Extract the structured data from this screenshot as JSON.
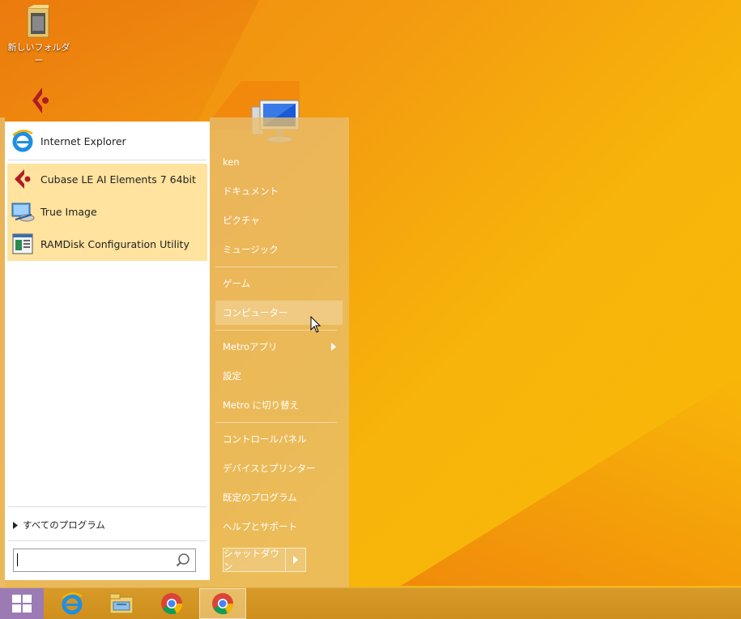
{
  "desktop": {
    "icons": [
      {
        "label": "新しいフォルダー"
      }
    ]
  },
  "start_menu": {
    "pinned": [
      {
        "label": "Internet Explorer",
        "icon": "ie-icon"
      }
    ],
    "recent": [
      {
        "label": "Cubase LE AI Elements 7 64bit",
        "icon": "cubase-icon"
      },
      {
        "label": "True Image",
        "icon": "true-image-icon"
      },
      {
        "label": "RAMDisk Configuration Utility",
        "icon": "ramdisk-icon"
      }
    ],
    "all_programs": "すべてのプログラム",
    "search": {
      "value": "",
      "placeholder": ""
    },
    "right": {
      "user": "ken",
      "documents": "ドキュメント",
      "pictures": "ピクチャ",
      "music": "ミュージック",
      "games": "ゲーム",
      "computer": "コンピューター",
      "metro_apps": "Metroアプリ",
      "settings": "設定",
      "switch_metro": "Metro に切り替え",
      "control_panel": "コントロールパネル",
      "devices_printers": "デバイスとプリンター",
      "default_programs": "既定のプログラム",
      "help_support": "ヘルプとサポート",
      "shutdown": "シャットダウン"
    }
  },
  "taskbar": {
    "items": [
      "start-button",
      "ie-icon",
      "file-explorer-icon",
      "chrome-icon",
      "chrome-icon-active"
    ]
  },
  "colors": {
    "accent": "#f39a10",
    "highlight": "#ffe39e",
    "start_button": "#9c7bb4"
  }
}
